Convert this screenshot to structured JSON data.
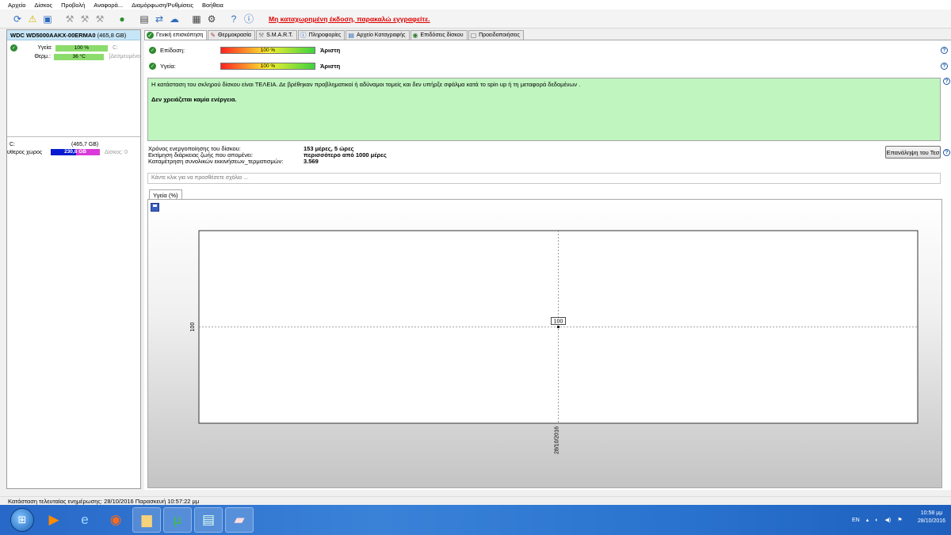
{
  "menu": [
    "Αρχείο",
    "Δίσκος",
    "Προβολή",
    "Αναφορά...",
    "Διαμόρφωση/Ρυθμίσεις",
    "Βοήθεια"
  ],
  "toolbar": {
    "registration_warning": "Μη καταχωρημένη έκδοση, παρακαλώ εγγραφείτε.",
    "icons": [
      "refresh-icon",
      "warning-icon",
      "screen-icon",
      "hdd-gray-icon",
      "hdd-gray-2-icon",
      "hdd-gray-3-icon",
      "globe-icon",
      "document-icon",
      "sync-icon",
      "cloud-icon",
      "monitor-icon",
      "gear-icon",
      "help-icon",
      "info-icon"
    ]
  },
  "left_panel": {
    "disk": {
      "model": "WDC WD5000AAKX-00ERMA0",
      "size": "(465,8 GB)",
      "health_label": "Υγεία:",
      "health_value": "100 %",
      "health_extra": "C:",
      "temp_label": "Θερμ.:",
      "temp_value": "36 °C",
      "temp_extra": "[Δεσμευμένο"
    },
    "partition": {
      "letter": "C:",
      "size": "(465,7 GB)",
      "free_label": "ύθερος χώρος",
      "free_value": "230,8 GB",
      "disk_label": "Δίσκος: 0"
    }
  },
  "tabs": [
    {
      "label": "Γενική επισκόπηση",
      "icon": "check-icon"
    },
    {
      "label": "Θερμοκρασία",
      "icon": "thermometer-icon"
    },
    {
      "label": "S.M.A.R.T.",
      "icon": "smart-icon"
    },
    {
      "label": "Πληροφορίες",
      "icon": "info-icon"
    },
    {
      "label": "Αρχείο Καταγραφής",
      "icon": "log-icon"
    },
    {
      "label": "Επιδόσεις δίσκου",
      "icon": "performance-icon"
    },
    {
      "label": "Προειδοποιήσεις",
      "icon": "alert-icon"
    }
  ],
  "overview": {
    "performance": {
      "label": "Επίδοση:",
      "value": "100 %",
      "fraction": 1.0,
      "verdict": "Άριστη"
    },
    "health": {
      "label": "Υγεία:",
      "value": "100 %",
      "fraction": 1.0,
      "verdict": "Άριστη"
    },
    "status_text": "Η κατάσταση του σκληρού δίσκου είναι ΤΕΛΕΙΑ. Δε βρέθηκαν προβληματικοί ή αδύναμοι τομείς και δεν υπήρξε σφάλμα κατά το spin up ή τη μεταφορά δεδομένων .",
    "action_text": "Δεν χρειάζεται καμία ενέργεια.",
    "info": [
      {
        "key": "Χρόνος ενεργοποίησης του δίσκου:",
        "value": "153 μέρες, 5 ώρες"
      },
      {
        "key": "Εκτίμηση διάρκειας ζωής που απομένει:",
        "value": "περισσότερο από 1000 μέρες"
      },
      {
        "key": "Καταμέτρηση συνολικών εκκινήσεων_τερματισμών:",
        "value": "3.569"
      }
    ],
    "retest_button": "Επανάληψη του Τεσ",
    "comment_placeholder": "Κάντε κλικ για να προσθέσετε σχόλιο ..."
  },
  "chart_tab_label": "Υγεία (%)",
  "chart_data": {
    "type": "line",
    "x": [
      "28/10/2016"
    ],
    "series": [
      {
        "values": [
          100
        ]
      }
    ],
    "data_labels": [
      "100"
    ],
    "ytick_labels": [
      "100"
    ],
    "xtick_labels": [
      "28/10/2016"
    ],
    "grid": true
  },
  "statusbar": {
    "text": "Κατάσταση τελευταίας ενημέρωσης: 28/10/2016 Παρασκευή 10:57:22 μμ"
  },
  "taskbar": {
    "items": [
      "start-orb-icon",
      "media-player-icon",
      "internet-explorer-icon",
      "firefox-icon",
      "folder-icon",
      "utorrent-icon",
      "monitor-app-icon",
      "hdd-app-icon"
    ],
    "tray_lang": "EN",
    "clock_time": "10:58 μμ",
    "clock_date": "28/10/2016"
  }
}
